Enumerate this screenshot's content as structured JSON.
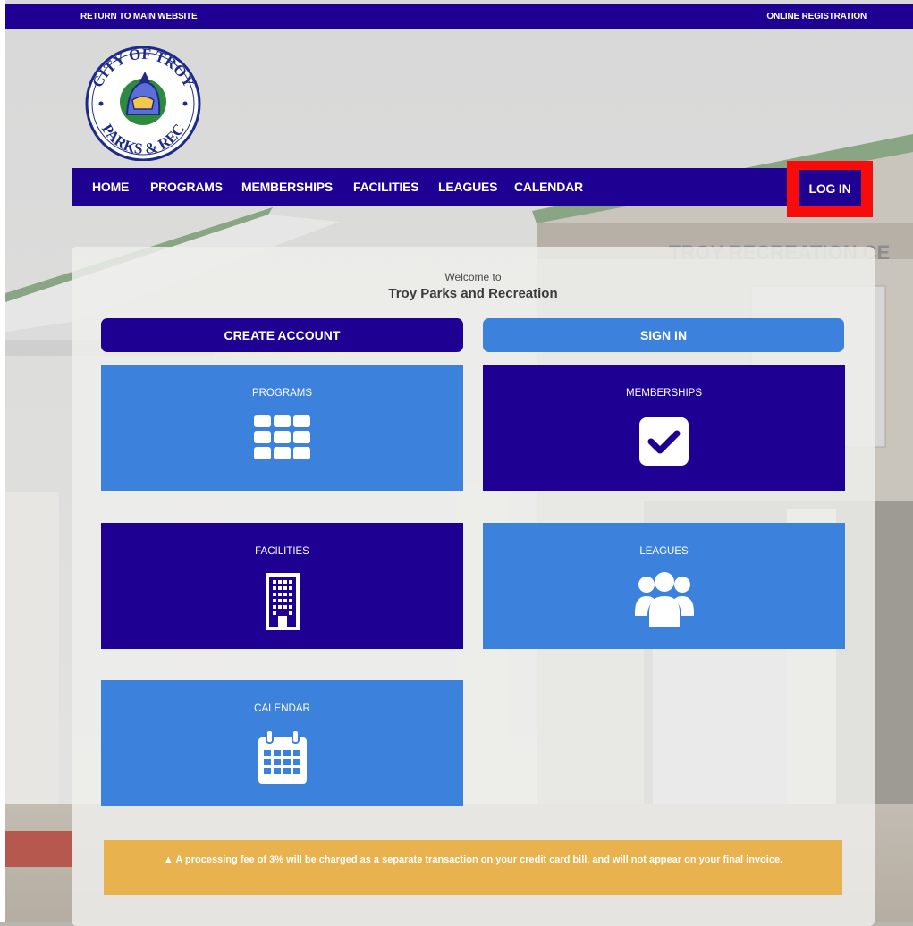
{
  "topbar": {
    "return_label": "RETURN TO MAIN WEBSITE",
    "registration_label": "ONLINE REGISTRATION"
  },
  "logo": {
    "text_top": "CITY OF TROY",
    "text_bottom": "PARKS & REC",
    "icon": "spartan-helmet-icon"
  },
  "nav": {
    "items": [
      "HOME",
      "PROGRAMS",
      "MEMBERSHIPS",
      "FACILITIES",
      "LEAGUES",
      "CALENDAR"
    ],
    "login_label": "LOG IN"
  },
  "welcome": {
    "pre": "Welcome to",
    "title": "Troy Parks and Recreation"
  },
  "actions": {
    "create_account": "CREATE ACCOUNT",
    "sign_in": "SIGN IN"
  },
  "tiles": [
    {
      "label": "PROGRAMS",
      "icon": "grid-icon"
    },
    {
      "label": "MEMBERSHIPS",
      "icon": "checkbox-icon"
    },
    {
      "label": "FACILITIES",
      "icon": "building-icon"
    },
    {
      "label": "LEAGUES",
      "icon": "users-icon"
    },
    {
      "label": "CALENDAR",
      "icon": "calendar-icon"
    }
  ],
  "notice": {
    "icon": "warning-icon",
    "text": "A processing fee of 3% will be charged as a separate transaction on your credit card bill, and will not appear on your final invoice."
  },
  "background": {
    "sign_text": "TROY RECREATION CE"
  },
  "colors": {
    "primary_dark": "#1e0093",
    "primary_light": "#3c82dc",
    "highlight_red": "#f80b0b",
    "notice_amber": "#e8b24f"
  }
}
